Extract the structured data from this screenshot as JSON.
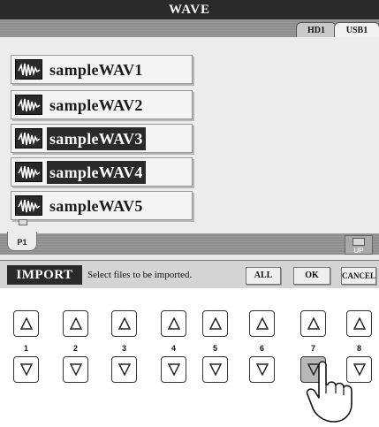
{
  "screen": {
    "title": "WAVE",
    "tabs": [
      {
        "label": "HD1"
      },
      {
        "label": "USB1"
      }
    ],
    "files": [
      {
        "name": "sampleWAV1",
        "icon": "wave-file-icon",
        "selected": false
      },
      {
        "name": "sampleWAV2",
        "icon": "wave-file-icon",
        "selected": false
      },
      {
        "name": "sampleWAV3",
        "icon": "wave-file-icon",
        "selected": true
      },
      {
        "name": "sampleWAV4",
        "icon": "wave-file-icon",
        "selected": true
      },
      {
        "name": "sampleWAV5",
        "icon": "wave-file-icon",
        "selected": false
      }
    ],
    "page_tab": "P1",
    "up_button": "UP",
    "action": {
      "mode_label": "IMPORT",
      "message": "Select files to be imported.",
      "all_label": "ALL",
      "ok_label": "OK",
      "cancel_label": "CANCEL"
    }
  },
  "hardware": {
    "numbers": [
      "1",
      "2",
      "3",
      "4",
      "5",
      "6",
      "7",
      "8"
    ],
    "pressed_button": "7-down",
    "pressed_color": "#b8b8b8"
  }
}
